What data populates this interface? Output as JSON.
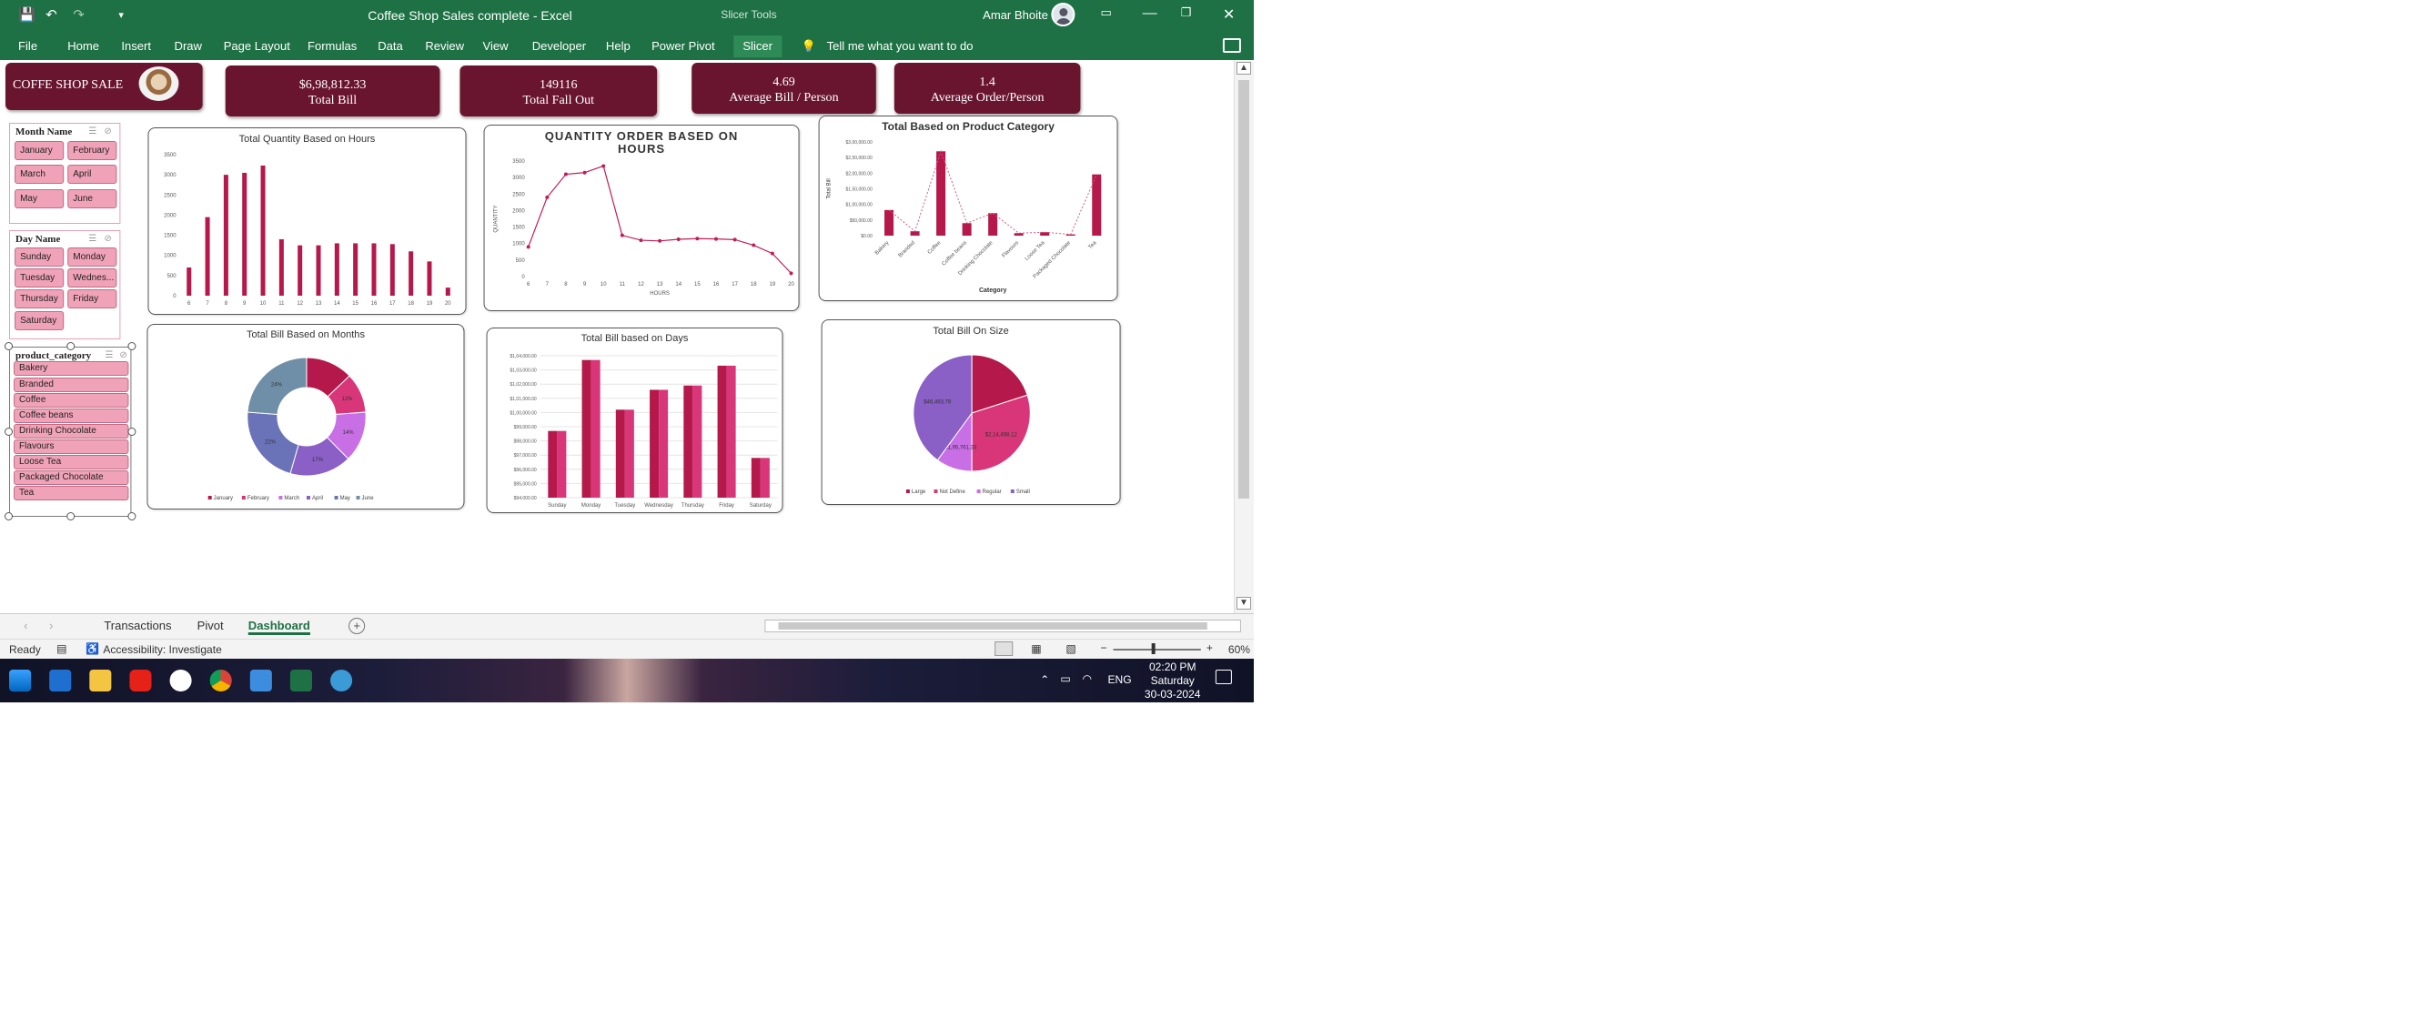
{
  "window": {
    "title": "Coffee Shop Sales complete  -  Excel",
    "context_tab": "Slicer Tools",
    "user": "Amar Bhoite"
  },
  "ribbon": {
    "tabs": [
      "File",
      "Home",
      "Insert",
      "Draw",
      "Page Layout",
      "Formulas",
      "Data",
      "Review",
      "View",
      "Developer",
      "Help",
      "Power Pivot",
      "Slicer"
    ],
    "tell_me": "Tell me what you want to do"
  },
  "dashboard": {
    "banner_title": "COFFE SHOP SALE",
    "kpis": [
      {
        "value": "$6,98,812.33",
        "label": "Total Bill"
      },
      {
        "value": "149116",
        "label": "Total Fall Out"
      },
      {
        "value": "4.69",
        "label": "Average Bill / Person"
      },
      {
        "value": "1.4",
        "label": "Average Order/Person"
      }
    ]
  },
  "slicers": {
    "month": {
      "title": "Month Name",
      "items": [
        "January",
        "February",
        "March",
        "April",
        "May",
        "June"
      ]
    },
    "day": {
      "title": "Day Name",
      "items": [
        "Sunday",
        "Monday",
        "Tuesday",
        "Wednes...",
        "Thursday",
        "Friday",
        "Saturday"
      ]
    },
    "category": {
      "title": "product_category",
      "items": [
        "Bakery",
        "Branded",
        "Coffee",
        "Coffee beans",
        "Drinking Chocolate",
        "Flavours",
        "Loose Tea",
        "Packaged Chocolate",
        "Tea"
      ]
    }
  },
  "chart_data": [
    {
      "type": "bar",
      "title": "Total Quantity Based on Hours",
      "categories": [
        "6",
        "7",
        "8",
        "9",
        "10",
        "11",
        "12",
        "13",
        "14",
        "15",
        "16",
        "17",
        "18",
        "19",
        "20"
      ],
      "values": [
        700,
        1950,
        3000,
        3050,
        3230,
        1400,
        1250,
        1250,
        1300,
        1300,
        1300,
        1280,
        1100,
        850,
        200
      ],
      "ylim": [
        0,
        3500
      ],
      "yticks": [
        "0",
        "500",
        "1000",
        "1500",
        "2000",
        "2500",
        "3000",
        "3500"
      ]
    },
    {
      "type": "line",
      "title": "QUANTITY ORDER BASED ON HOURS",
      "xlabel": "HOURS",
      "ylabel": "QUANTITY",
      "categories": [
        "6",
        "7",
        "8",
        "9",
        "10",
        "11",
        "12",
        "13",
        "14",
        "15",
        "16",
        "17",
        "18",
        "19",
        "20"
      ],
      "values": [
        900,
        2400,
        3100,
        3150,
        3350,
        1250,
        1100,
        1080,
        1130,
        1150,
        1140,
        1120,
        950,
        700,
        100
      ],
      "ylim": [
        0,
        3500
      ],
      "yticks": [
        "0",
        "500",
        "1000",
        "1500",
        "2000",
        "2500",
        "3000",
        "3500"
      ]
    },
    {
      "type": "line",
      "title": "Total Based on Product Category",
      "xlabel": "Category",
      "ylabel": "Total Bill",
      "categories": [
        "Bakery",
        "Branded",
        "Coffee",
        "Coffee beans",
        "Drinking Chocolate",
        "Flavours",
        "Loose Tea",
        "Packaged Chocolate",
        "Tea"
      ],
      "values": [
        82000,
        14000,
        270000,
        40000,
        72000,
        8000,
        11000,
        4000,
        196000
      ],
      "ylim": [
        0,
        300000
      ],
      "yticks": [
        "$0.00",
        "$50,000.00",
        "$1,00,000.00",
        "$1,50,000.00",
        "$2,00,000.00",
        "$2,50,000.00",
        "$3,00,000.00"
      ]
    },
    {
      "type": "pie",
      "title": "Total Bill Based on Months",
      "categories": [
        "January",
        "February",
        "March",
        "April",
        "May",
        "June"
      ],
      "values": [
        13,
        11,
        14,
        17,
        22,
        24
      ],
      "labels": [
        "",
        "11%",
        "14%",
        "17%",
        "22%",
        "24%"
      ],
      "colors": [
        "#b5184a",
        "#d9367a",
        "#c86fe6",
        "#8a5fc6",
        "#6b73b8",
        "#6f8fa8"
      ]
    },
    {
      "type": "bar",
      "title": "Total Bill based on Days",
      "categories": [
        "Sunday",
        "Monday",
        "Tuesday",
        "Wednesday",
        "Thursday",
        "Friday",
        "Saturday"
      ],
      "values": [
        98700,
        103700,
        100200,
        101600,
        101900,
        103300,
        96800
      ],
      "ylim": [
        94000,
        104000
      ],
      "yticks": [
        "$94,000.00",
        "$95,000.00",
        "$96,000.00",
        "$97,000.00",
        "$98,000.00",
        "$99,000.00",
        "$1,00,000.00",
        "$1,01,000.00",
        "$1,02,000.00",
        "$1,03,000.00",
        "$1,04,000.00"
      ]
    },
    {
      "type": "pie",
      "title": "Total Bill On Size",
      "categories": [
        "Large",
        "Not Define",
        "Regular",
        "Small"
      ],
      "values": [
        2,
        3,
        1,
        4
      ],
      "labels": [
        "",
        "$2,14,498.12",
        "$1,95,761.33",
        "$46,493.79"
      ],
      "colors": [
        "#b5184a",
        "#d9367a",
        "#c86fe6",
        "#8a5fc6"
      ]
    }
  ],
  "sheets": {
    "tabs": [
      "Transactions",
      "Pivot",
      "Dashboard"
    ],
    "active": "Dashboard"
  },
  "status": {
    "ready": "Ready",
    "accessibility": "Accessibility: Investigate",
    "zoom": "60%"
  },
  "taskbar": {
    "lang": "ENG",
    "time": "02:20 PM",
    "day": "Saturday",
    "date": "30-03-2024"
  }
}
